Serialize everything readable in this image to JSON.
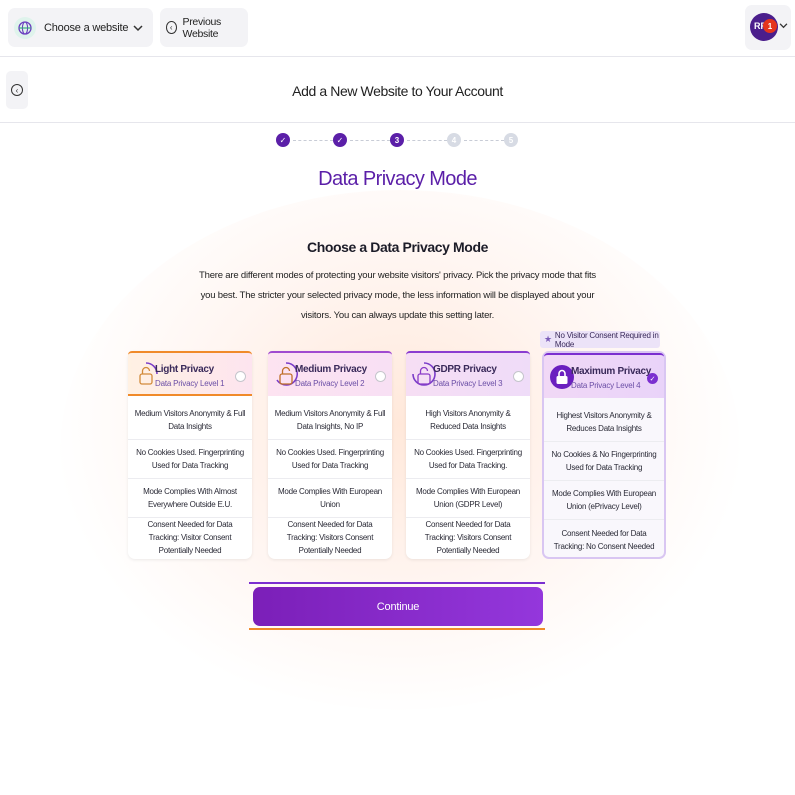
{
  "topbar": {
    "site_select_label": "Choose a website",
    "prev_site_label": "Previous Website",
    "avatar_initials": "RF",
    "notification_count": "1"
  },
  "page": {
    "title": "Add a New Website to Your Account"
  },
  "stepper": {
    "steps": [
      {
        "label": "✓",
        "state": "done"
      },
      {
        "label": "✓",
        "state": "done"
      },
      {
        "label": "3",
        "state": "current"
      },
      {
        "label": "4",
        "state": "todo"
      },
      {
        "label": "5",
        "state": "todo"
      }
    ]
  },
  "main": {
    "section_title": "Data Privacy Mode",
    "sub_title": "Choose a Data Privacy Mode",
    "description": "There are different modes of protecting your website visitors' privacy. Pick the privacy mode that fits you best. The stricter your selected privacy mode, the less information will be displayed about your visitors. You can always update this setting later.",
    "consent_badge": "No Visitor Consent Required in Mode",
    "continue_label": "Continue"
  },
  "cards": [
    {
      "name": "Light Privacy",
      "level": "Data Privacy Level 1",
      "selected": false,
      "rows": [
        "Medium Visitors Anonymity & Full Data Insights",
        "No Cookies Used. Fingerprinting Used for Data Tracking",
        "Mode Complies With Almost Everywhere Outside E.U.",
        "Consent Needed for Data Tracking: Visitor Consent Potentially Needed"
      ]
    },
    {
      "name": "Medium Privacy",
      "level": "Data Privacy Level 2",
      "selected": false,
      "rows": [
        "Medium Visitors Anonymity & Full Data Insights, No IP",
        "No Cookies Used. Fingerprinting Used for Data Tracking",
        "Mode Complies With European Union",
        "Consent Needed for Data Tracking: Visitors Consent Potentially Needed"
      ]
    },
    {
      "name": "GDPR Privacy",
      "level": "Data Privacy Level 3",
      "selected": false,
      "rows": [
        "High Visitors Anonymity & Reduced Data Insights",
        "No Cookies Used. Fingerprinting Used for Data Tracking.",
        "Mode Complies With European Union (GDPR Level)",
        "Consent Needed for Data Tracking: Visitors Consent Potentially Needed"
      ]
    },
    {
      "name": "Maximum Privacy",
      "level": "Data Privacy Level 4",
      "selected": true,
      "rows": [
        "Highest Visitors Anonymity & Reduces Data Insights",
        "No Cookies & No Fingerprinting Used for Data Tracking",
        "Mode Complies With European Union (ePrivacy Level)",
        "Consent Needed for Data Tracking: No Consent Needed"
      ]
    }
  ],
  "colors": {
    "accent": "#5b1fa8",
    "orange": "#f08a2a",
    "button": "#8a2fd0"
  },
  "icons": {
    "globe": "globe-icon",
    "chevron": "chevron-down-icon",
    "back": "arrow-left-circle-icon",
    "lock": "lock-icon",
    "star": "star-icon",
    "check": "check-icon"
  }
}
